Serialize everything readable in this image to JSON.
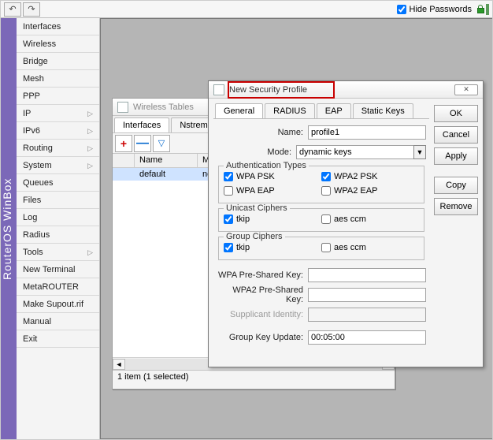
{
  "topbar": {
    "hide_passwords_label": "Hide Passwords",
    "hide_passwords_checked": true
  },
  "brand": "RouterOS WinBox",
  "sidebar": {
    "items": [
      {
        "label": "Interfaces",
        "submenu": false
      },
      {
        "label": "Wireless",
        "submenu": false
      },
      {
        "label": "Bridge",
        "submenu": false
      },
      {
        "label": "Mesh",
        "submenu": false
      },
      {
        "label": "PPP",
        "submenu": false
      },
      {
        "label": "IP",
        "submenu": true
      },
      {
        "label": "IPv6",
        "submenu": true
      },
      {
        "label": "Routing",
        "submenu": true
      },
      {
        "label": "System",
        "submenu": true
      },
      {
        "label": "Queues",
        "submenu": false
      },
      {
        "label": "Files",
        "submenu": false
      },
      {
        "label": "Log",
        "submenu": false
      },
      {
        "label": "Radius",
        "submenu": false
      },
      {
        "label": "Tools",
        "submenu": true
      },
      {
        "label": "New Terminal",
        "submenu": false
      },
      {
        "label": "MetaROUTER",
        "submenu": false
      },
      {
        "label": "Make Supout.rif",
        "submenu": false
      },
      {
        "label": "Manual",
        "submenu": false
      },
      {
        "label": "Exit",
        "submenu": false
      }
    ]
  },
  "win1": {
    "title": "Wireless Tables",
    "tabs": [
      "Interfaces",
      "Nstreme Dua"
    ],
    "col_name": "Name",
    "col_mode": "Mo",
    "row_name": "default",
    "row_mode": "non",
    "status": "1 item (1 selected)"
  },
  "win2": {
    "title": "New Security Profile",
    "tabs": [
      "General",
      "RADIUS",
      "EAP",
      "Static Keys"
    ],
    "buttons": {
      "ok": "OK",
      "cancel": "Cancel",
      "apply": "Apply",
      "copy": "Copy",
      "remove": "Remove"
    },
    "labels": {
      "name": "Name:",
      "mode": "Mode:",
      "auth": "Authentication Types",
      "unicast": "Unicast Ciphers",
      "group": "Group Ciphers",
      "wpa_psk": "WPA Pre-Shared Key:",
      "wpa2_psk": "WPA2 Pre-Shared Key:",
      "supp": "Supplicant Identity:",
      "gku": "Group Key Update:"
    },
    "values": {
      "name": "profile1",
      "mode": "dynamic keys",
      "gku": "00:05:00"
    },
    "auth": {
      "wpa_psk": {
        "label": "WPA PSK",
        "checked": true
      },
      "wpa2_psk": {
        "label": "WPA2 PSK",
        "checked": true
      },
      "wpa_eap": {
        "label": "WPA EAP",
        "checked": false
      },
      "wpa2_eap": {
        "label": "WPA2 EAP",
        "checked": false
      }
    },
    "unicast": {
      "tkip": {
        "label": "tkip",
        "checked": true
      },
      "aes": {
        "label": "aes ccm",
        "checked": false
      }
    },
    "groupc": {
      "tkip": {
        "label": "tkip",
        "checked": true
      },
      "aes": {
        "label": "aes ccm",
        "checked": false
      }
    }
  }
}
